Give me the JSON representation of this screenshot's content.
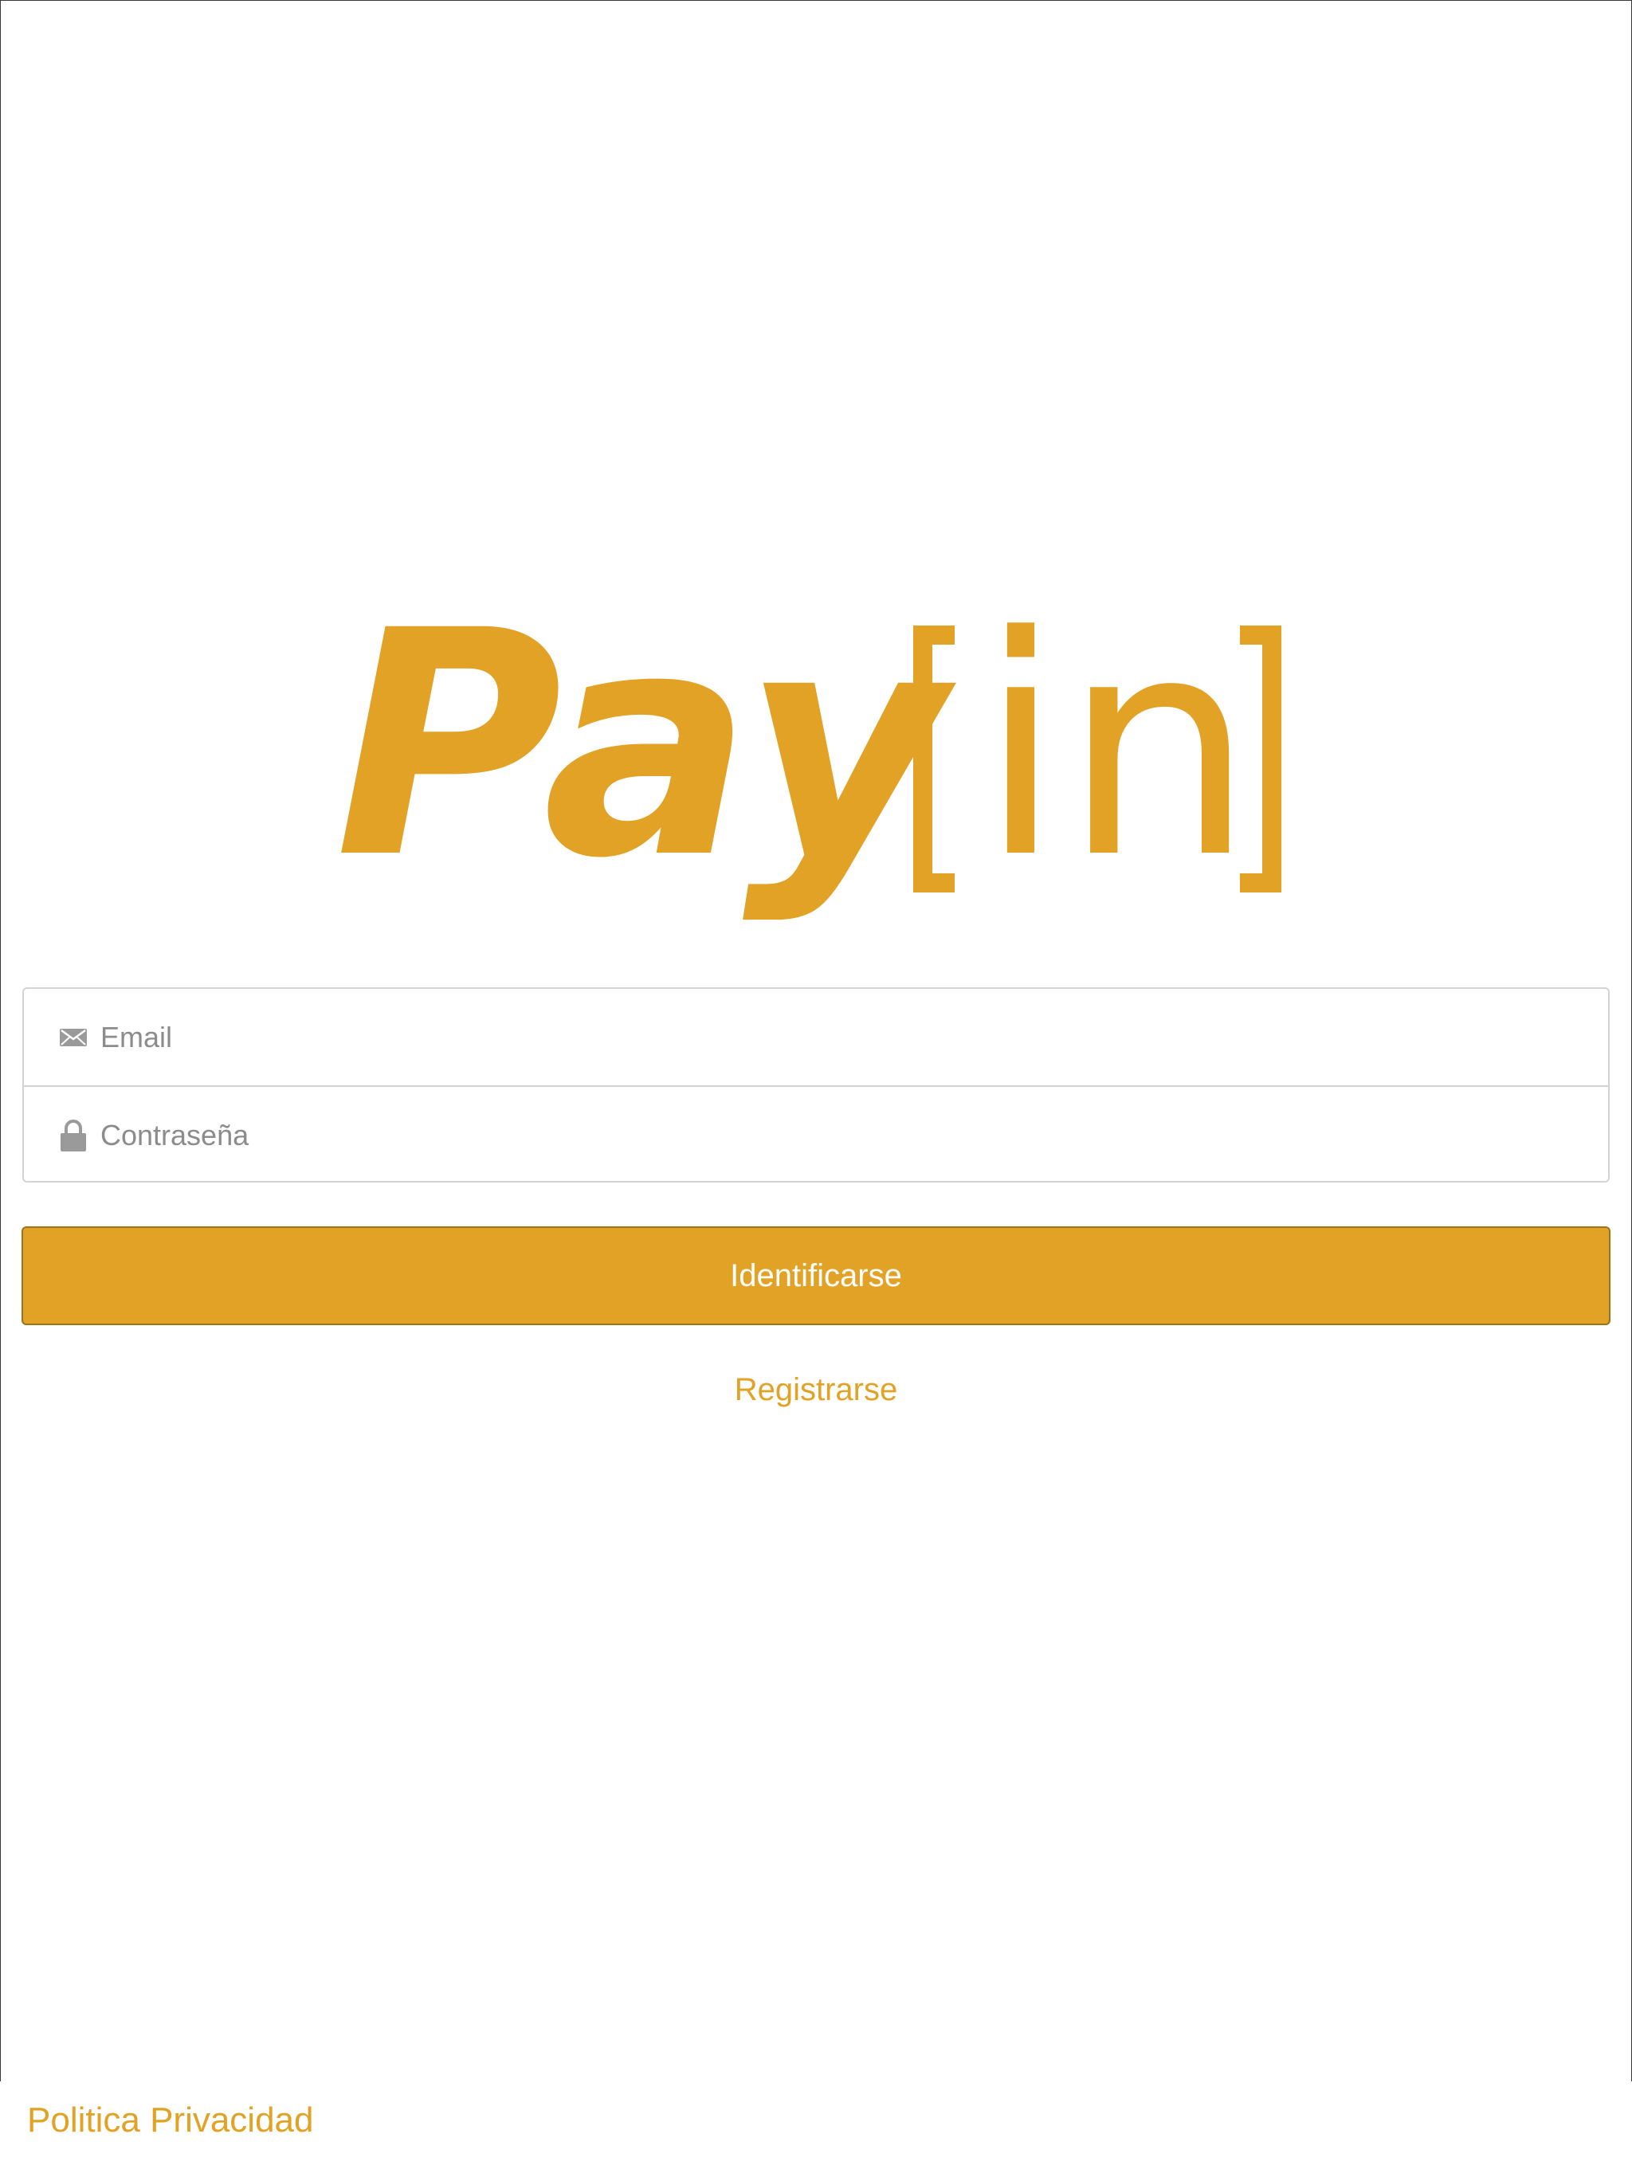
{
  "brand": {
    "name_part1": "Pay",
    "name_part2": "in",
    "color": "#E1A225"
  },
  "login_form": {
    "email": {
      "placeholder": "Email",
      "value": "",
      "icon": "envelope-icon"
    },
    "password": {
      "placeholder": "Contraseña",
      "value": "",
      "icon": "lock-icon"
    },
    "submit_label": "Identificarse",
    "register_label": "Registrarse"
  },
  "footer": {
    "privacy_label": "Politica Privacidad"
  }
}
